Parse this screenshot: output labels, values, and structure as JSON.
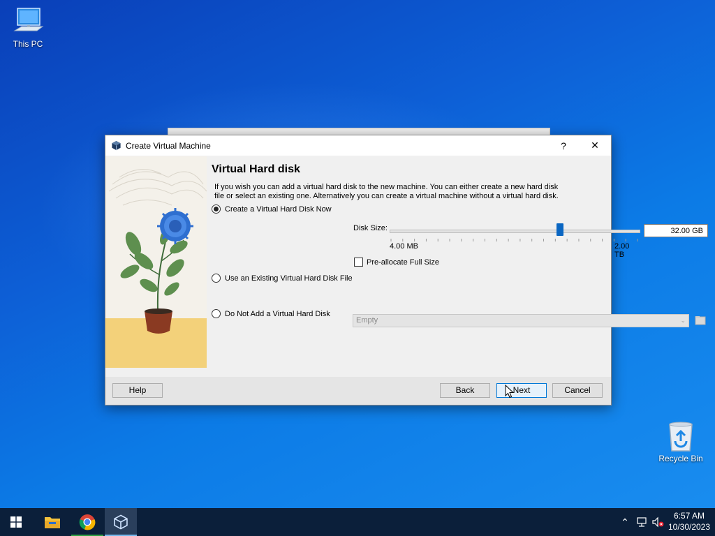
{
  "desktop": {
    "icons": [
      {
        "label": "This PC",
        "icon": "monitor-icon"
      },
      {
        "label": "Recycle Bin",
        "icon": "recycle-bin-icon"
      }
    ]
  },
  "dialog": {
    "title": "Create Virtual Machine",
    "help_glyph": "?",
    "close_glyph": "✕",
    "heading": "Virtual Hard disk",
    "description_line1": "If you wish you can add a virtual hard disk to the new machine. You can either create a new hard disk",
    "description_line2": "file or select an existing one. Alternatively you can create a virtual machine without a virtual hard disk.",
    "options": {
      "create_now": {
        "label": "Create a Virtual Hard Disk Now",
        "checked": true
      },
      "use_existing": {
        "label": "Use an Existing Virtual Hard Disk File",
        "checked": false
      },
      "do_not_add": {
        "label": "Do Not Add a Virtual Hard Disk",
        "checked": false
      }
    },
    "disk_size": {
      "label": "Disk Size:",
      "value": "32.00 GB",
      "min_label": "4.00 MB",
      "max_label": "2.00 TB",
      "slider_position": 0.68
    },
    "preallocate": {
      "label": "Pre-allocate Full Size",
      "checked": false
    },
    "existing_file_combo": {
      "value": "Empty"
    },
    "buttons": {
      "help": "Help",
      "back": "Back",
      "next": "Next",
      "cancel": "Cancel"
    }
  },
  "taskbar": {
    "apps": [
      {
        "name": "start",
        "icon": "windows-start-icon"
      },
      {
        "name": "file-explorer",
        "icon": "folder-icon"
      },
      {
        "name": "chrome",
        "icon": "chrome-icon"
      },
      {
        "name": "virtualbox",
        "icon": "virtualbox-icon",
        "active": true
      }
    ],
    "time": "6:57 AM",
    "date": "10/30/2023"
  },
  "colors": {
    "accent": "#0078d7",
    "slider_thumb": "#0a66c2",
    "taskbar": "#0b1f3a",
    "dialog_bg": "#f0f0f0"
  }
}
